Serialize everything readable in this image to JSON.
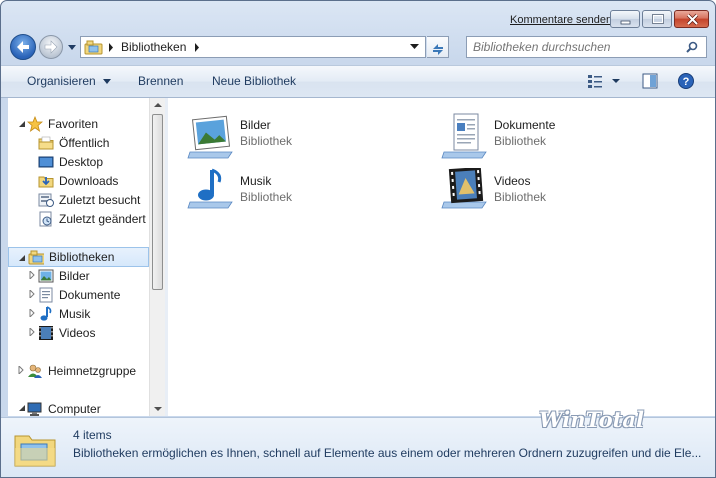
{
  "titlebar": {
    "feedback_link": "Kommentare senden"
  },
  "address": {
    "crumb": "Bibliotheken"
  },
  "search": {
    "placeholder": "Bibliotheken durchsuchen"
  },
  "toolbar": {
    "organize_label": "Organisieren",
    "burn_label": "Brennen",
    "new_library_label": "Neue Bibliothek"
  },
  "navpane": {
    "favorites": {
      "label": "Favoriten",
      "items": [
        {
          "label": "Öffentlich",
          "icon": "folder-icon"
        },
        {
          "label": "Desktop",
          "icon": "desktop-icon"
        },
        {
          "label": "Downloads",
          "icon": "downloads-folder-icon"
        },
        {
          "label": "Zuletzt besucht",
          "icon": "recent-places-icon"
        },
        {
          "label": "Zuletzt geändert",
          "icon": "recent-changes-icon"
        }
      ]
    },
    "libraries": {
      "label": "Bibliotheken",
      "items": [
        {
          "label": "Bilder",
          "icon": "pictures-icon"
        },
        {
          "label": "Dokumente",
          "icon": "documents-icon"
        },
        {
          "label": "Musik",
          "icon": "music-icon"
        },
        {
          "label": "Videos",
          "icon": "videos-icon"
        }
      ]
    },
    "homegroup": {
      "label": "Heimnetzgruppe"
    },
    "computer": {
      "label": "Computer"
    }
  },
  "content": {
    "libraries": [
      {
        "name": "Bilder",
        "type": "Bibliothek",
        "icon": "pictures-library-icon"
      },
      {
        "name": "Dokumente",
        "type": "Bibliothek",
        "icon": "documents-library-icon"
      },
      {
        "name": "Musik",
        "type": "Bibliothek",
        "icon": "music-library-icon"
      },
      {
        "name": "Videos",
        "type": "Bibliothek",
        "icon": "videos-library-icon"
      }
    ]
  },
  "details": {
    "count": "4 items",
    "description": "Bibliotheken ermöglichen es Ihnen, schnell auf Elemente aus einem oder mehreren Ordnern zuzugreifen und die Ele..."
  },
  "watermark": "WinTotal",
  "colors": {
    "selection": "#d6e8fb",
    "toolbar_text": "#1e3a5f",
    "secondary_text": "#6d6d6d"
  }
}
